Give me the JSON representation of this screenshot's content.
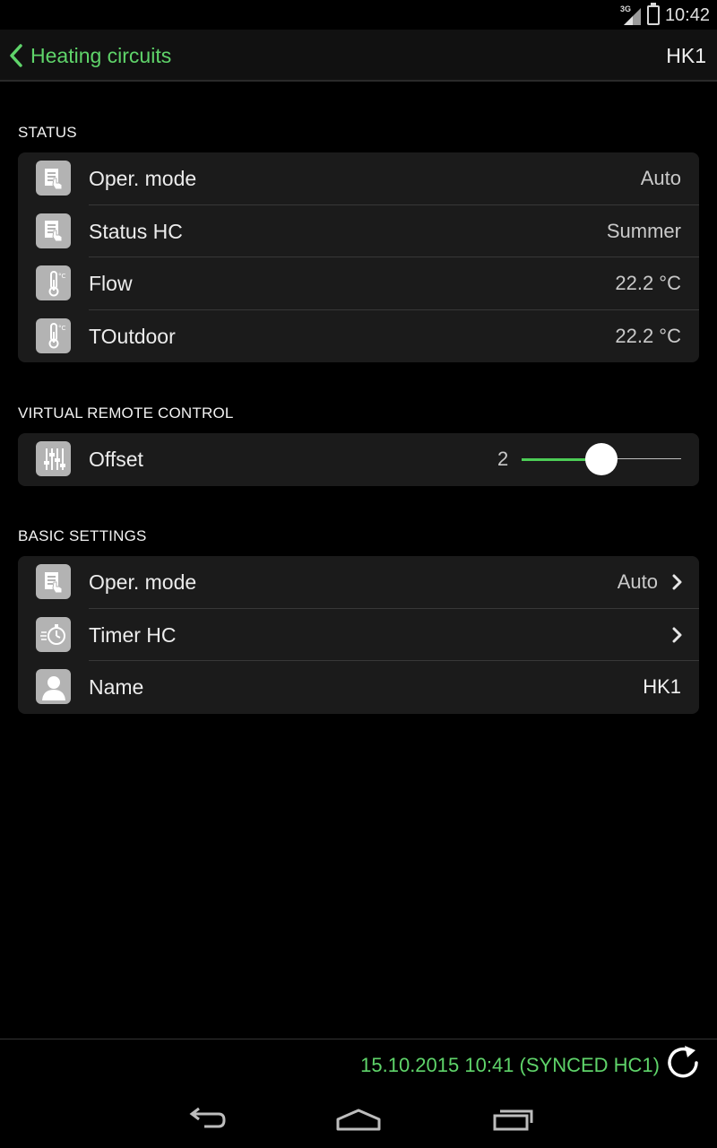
{
  "status_bar": {
    "network": "3G",
    "time": "10:42"
  },
  "action_bar": {
    "back_label": "Heating circuits",
    "title": "HK1"
  },
  "sections": {
    "status": {
      "title": "STATUS",
      "rows": [
        {
          "icon": "hand-pointer-doc-icon",
          "label": "Oper. mode",
          "value": "Auto"
        },
        {
          "icon": "hand-pointer-doc-icon",
          "label": "Status HC",
          "value": "Summer"
        },
        {
          "icon": "thermometer-icon",
          "label": "Flow",
          "value": "22.2 °C"
        },
        {
          "icon": "thermometer-icon",
          "label": "TOutdoor",
          "value": "22.2 °C"
        }
      ]
    },
    "remote": {
      "title": "VIRTUAL REMOTE CONTROL",
      "offset": {
        "icon": "sliders-icon",
        "label": "Offset",
        "value": "2",
        "fraction": 0.55
      }
    },
    "basic": {
      "title": "BASIC SETTINGS",
      "rows": [
        {
          "icon": "hand-pointer-doc-icon",
          "label": "Oper. mode",
          "value": "Auto"
        },
        {
          "icon": "stopwatch-icon",
          "label": "Timer HC",
          "value": ""
        },
        {
          "icon": "person-icon",
          "label": "Name",
          "value": "HK1"
        }
      ]
    }
  },
  "footer": {
    "sync_text": "15.10.2015 10:41 (SYNCED HC1)"
  },
  "colors": {
    "accent": "#5fd46a",
    "card": "#1b1b1b",
    "background": "#000000"
  }
}
